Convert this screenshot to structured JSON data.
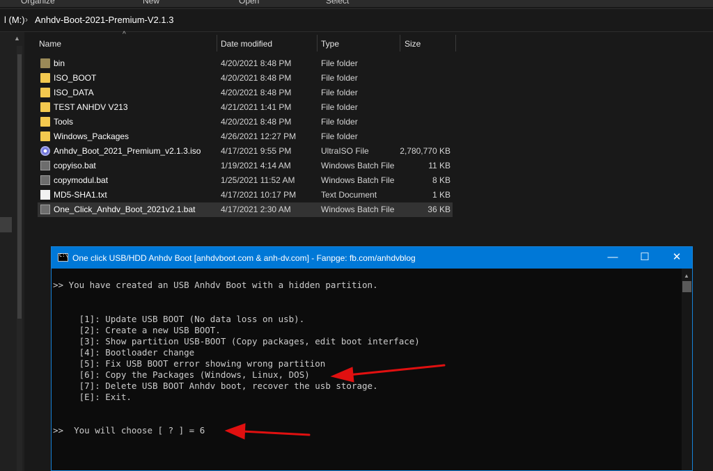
{
  "ribbon": {
    "organize": "Organize",
    "new": "New",
    "open": "Open",
    "select": "Select"
  },
  "address": {
    "drive": "l (M:)",
    "folder": "Anhdv-Boot-2021-Premium-V2.1.3"
  },
  "columns": {
    "name": "Name",
    "date": "Date modified",
    "type": "Type",
    "size": "Size"
  },
  "files": [
    {
      "name": "bin",
      "date": "4/20/2021 8:48 PM",
      "type": "File folder",
      "size": "",
      "icon": "folder-icon-dark"
    },
    {
      "name": "ISO_BOOT",
      "date": "4/20/2021 8:48 PM",
      "type": "File folder",
      "size": "",
      "icon": "folder-icon"
    },
    {
      "name": "ISO_DATA",
      "date": "4/20/2021 8:48 PM",
      "type": "File folder",
      "size": "",
      "icon": "folder-icon"
    },
    {
      "name": "TEST ANHDV V213",
      "date": "4/21/2021 1:41 PM",
      "type": "File folder",
      "size": "",
      "icon": "folder-icon"
    },
    {
      "name": "Tools",
      "date": "4/20/2021 8:48 PM",
      "type": "File folder",
      "size": "",
      "icon": "folder-icon"
    },
    {
      "name": "Windows_Packages",
      "date": "4/26/2021 12:27 PM",
      "type": "File folder",
      "size": "",
      "icon": "folder-icon"
    },
    {
      "name": "Anhdv_Boot_2021_Premium_v2.1.3.iso",
      "date": "4/17/2021 9:55 PM",
      "type": "UltraISO File",
      "size": "2,780,770 KB",
      "icon": "disc-icon"
    },
    {
      "name": "copyiso.bat",
      "date": "1/19/2021 4:14 AM",
      "type": "Windows Batch File",
      "size": "11 KB",
      "icon": "batch-file-icon"
    },
    {
      "name": "copymodul.bat",
      "date": "1/25/2021 11:52 AM",
      "type": "Windows Batch File",
      "size": "8 KB",
      "icon": "batch-file-icon"
    },
    {
      "name": "MD5-SHA1.txt",
      "date": "4/17/2021 10:17 PM",
      "type": "Text Document",
      "size": "1 KB",
      "icon": "text-file-icon"
    },
    {
      "name": "One_Click_Anhdv_Boot_2021v2.1.bat",
      "date": "4/17/2021 2:30 AM",
      "type": "Windows Batch File",
      "size": "36 KB",
      "icon": "batch-file-icon"
    }
  ],
  "selected_index": 10,
  "console": {
    "title": "One click USB/HDD Anhdv Boot [anhdvboot.com & anh-dv.com] -  Fanpge: fb.com/anhdvblog",
    "icon_text": "C:\\",
    "lines": [
      ">> You have created an USB Anhdv Boot with a hidden partition.",
      "     [1]: Update USB BOOT (No data loss on usb).",
      "     [2]: Create a new USB BOOT.",
      "     [3]: Show partition USB-BOOT (Copy packages, edit boot interface)",
      "     [4]: Bootloader change",
      "     [5]: Fix USB BOOT error showing wrong partition",
      "     [6]: Copy the Packages (Windows, Linux, DOS)",
      "     [7]: Delete USB BOOT Anhdv boot, recover the usb storage.",
      "     [E]: Exit.",
      ">>  You will choose [ ? ] = 6"
    ],
    "buttons": {
      "minimize": "—",
      "maximize": "☐",
      "close": "✕"
    }
  },
  "colors": {
    "titlebar": "#0078d7",
    "console_bg": "#0c0c0c",
    "console_text": "#cccccc",
    "explorer_bg": "#191919",
    "arrow": "#e01010"
  }
}
